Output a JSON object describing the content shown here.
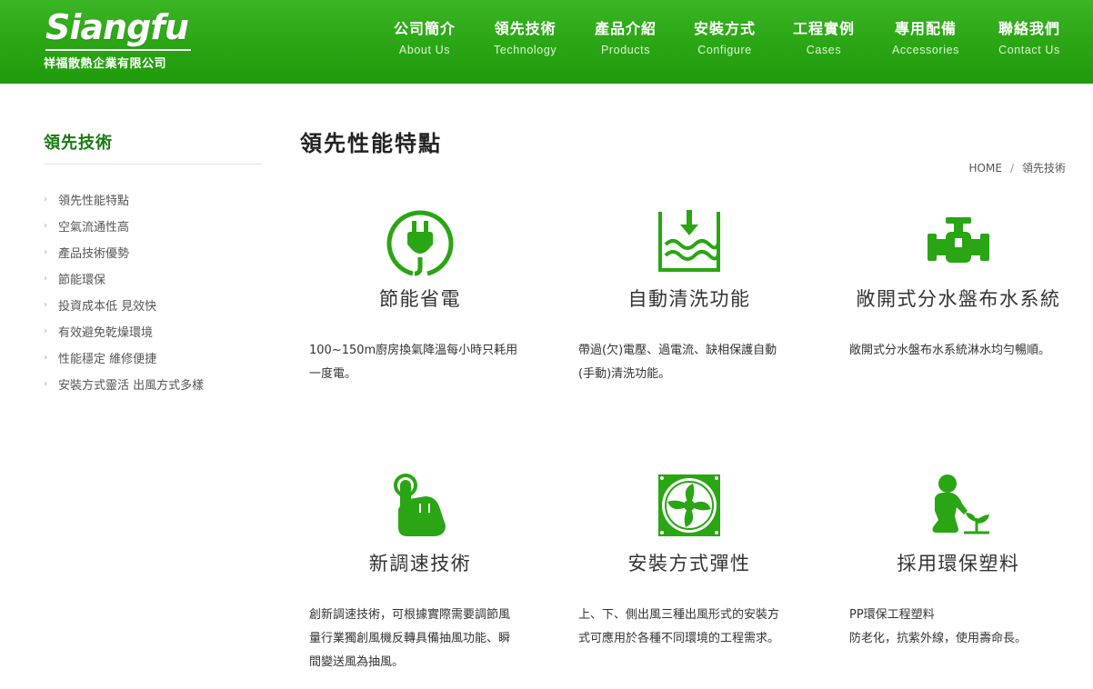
{
  "brand": {
    "logo_text": "Siangfu",
    "company_name": "祥福散熱企業有限公司",
    "color": "#2aa514"
  },
  "nav": [
    {
      "zh": "公司簡介",
      "en": "About Us"
    },
    {
      "zh": "領先技術",
      "en": "Technology"
    },
    {
      "zh": "產品介紹",
      "en": "Products"
    },
    {
      "zh": "安裝方式",
      "en": "Configure"
    },
    {
      "zh": "工程實例",
      "en": "Cases"
    },
    {
      "zh": "專用配備",
      "en": "Accessories"
    },
    {
      "zh": "聯絡我們",
      "en": "Contact Us"
    }
  ],
  "sidebar": {
    "title": "領先技術",
    "items": [
      "領先性能特點",
      "空氣流通性高",
      "產品技術優勢",
      "節能環保",
      "投資成本低 見效快",
      "有效避免乾燥環境",
      "性能穩定 維修便捷",
      "安裝方式靈活 出風方式多樣"
    ]
  },
  "page": {
    "title": "領先性能特點",
    "breadcrumb": {
      "home": "HOME",
      "sep": "/",
      "current": "領先技術"
    }
  },
  "features": [
    {
      "icon": "power-plug-icon",
      "title": "節能省電",
      "lines": [
        "100~150m廚房換氣降溫每小時只耗用",
        "一度電。"
      ]
    },
    {
      "icon": "water-clean-icon",
      "title": "自動清洗功能",
      "lines": [
        "帶過(欠)電壓、過電流、缺相保護自動",
        "(手動)清洗功能。"
      ]
    },
    {
      "icon": "pipe-valve-icon",
      "title": "敞開式分水盤布水系統",
      "lines": [
        "敞開式分水盤布水系統淋水均勻暢順。"
      ]
    },
    {
      "icon": "touch-hand-icon",
      "title": "新調速技術",
      "lines": [
        "創新調速技術，可根據實際需要調節風",
        "量行業獨創風機反轉具備抽風功能、瞬",
        "間變送風為抽風。"
      ]
    },
    {
      "icon": "fan-icon",
      "title": "安裝方式彈性",
      "lines": [
        "上、下、側出風三種出風形式的安裝方",
        "式可應用於各種不同環境的工程需求。"
      ]
    },
    {
      "icon": "eco-plant-icon",
      "title": "採用環保塑料",
      "lines": [
        "PP環保工程塑料",
        "防老化，抗紫外線，使用壽命長。"
      ]
    }
  ]
}
